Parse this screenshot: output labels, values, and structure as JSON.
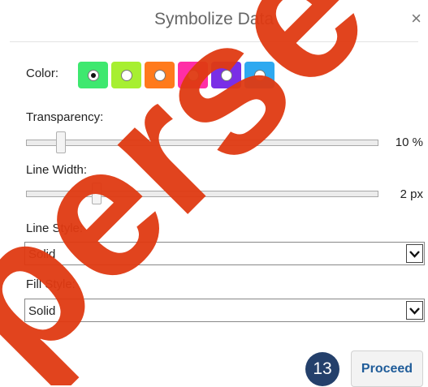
{
  "dialog": {
    "title": "Symbolize Data",
    "close_glyph": "×"
  },
  "color": {
    "label": "Color:",
    "swatches": [
      {
        "hex": "#3ee86f",
        "selected": true
      },
      {
        "hex": "#a7ef31",
        "selected": false
      },
      {
        "hex": "#ff7a1c",
        "selected": false
      },
      {
        "hex": "#ff2ea6",
        "selected": false
      },
      {
        "hex": "#7a2fe6",
        "selected": false
      },
      {
        "hex": "#2ea9f0",
        "selected": false
      }
    ]
  },
  "transparency": {
    "label": "Transparency:",
    "value": 10,
    "value_text": "10 %"
  },
  "line_width": {
    "label": "Line Width:",
    "value": 2,
    "value_text": "2 px"
  },
  "line_style": {
    "label": "Line Style:",
    "selected": "Solid"
  },
  "fill_style": {
    "label": "Fill Style:",
    "selected": "Solid"
  },
  "footer": {
    "step_badge": "13",
    "proceed_label": "Proceed"
  },
  "watermark": {
    "text": "perse",
    "color": "#e03a12"
  }
}
